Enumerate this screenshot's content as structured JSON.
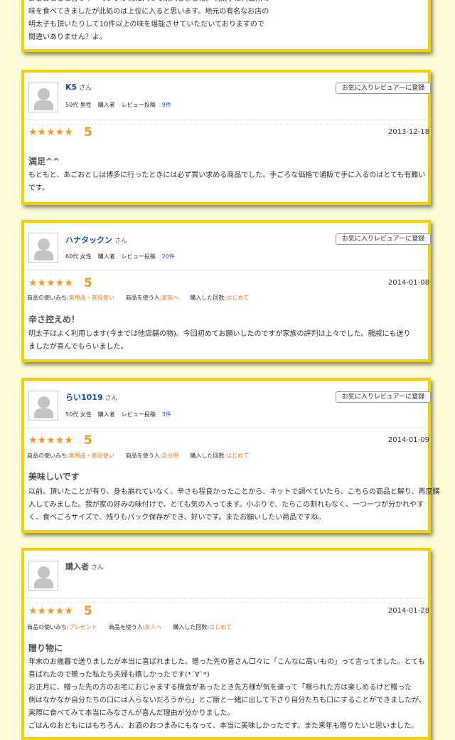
{
  "top_review": {
    "lines": [
      "あごおとしと言うネーミングが気に入って購入しました。明太子は何面所の",
      "味を食べてきましたが此処のは上位に入ると思います。地元の有名なお店の",
      "明太子も頂いたりして10件以上の味を堪能させていただいておりますので",
      "間違いありません？よ。"
    ]
  },
  "labels": {
    "san": "さん",
    "fav_button": "お気に入りレビュアーに登録",
    "buyer": "購入者",
    "review_posts": "レビュー投稿",
    "usage": "商品の使いみち:",
    "user": "商品を使う人:",
    "times": "購入した回数:"
  },
  "reviews": [
    {
      "name": "K5",
      "age_gender": "50代 男性",
      "count": "9件",
      "stars": "★★★★★",
      "score": "5",
      "date": "2013-12-18",
      "title": "満足^^",
      "body": [
        "もともと、あごおとしは博多に行ったときには必ず買い求める商品でした。手ごろな価格で通販で手に入るのはとても有難い",
        "です。"
      ]
    },
    {
      "name": "ハナタックン",
      "age_gender": "60代 女性",
      "count": "20件",
      "stars": "★★★★★",
      "score": "5",
      "date": "2014-01-08",
      "usage": "実用品・普段使い",
      "user": "家族へ",
      "times": "はじめて",
      "title": "辛さ控えめ！",
      "body": [
        "明太子はよく利用します(今までは他店舗の物)。今回初めてお願いしたのですが家族の評判は上々でした。親戚にも送り",
        "ましたが喜んでもらいました。"
      ]
    },
    {
      "name": "らい1019",
      "age_gender": "50代 女性",
      "count": "3件",
      "stars": "★★★★★",
      "score": "5",
      "date": "2014-01-09",
      "usage": "実用品・普段使い",
      "user": "自分用",
      "times": "はじめて",
      "title": "美味しいです",
      "body": [
        "以前、頂いたことが有り、身も崩れていなく、辛さも程良かったことから、ネットで調べていたら、こちらの商品と解り、再度購",
        "入してみました。我が家の好みの味付けで、とても気の入ってます。小ぶりで、たらこの割れもなく、一つ一つが分かれやす",
        "く、食べごろサイズで、残りもパック保存ができ、好いです。またお願いしたい商品ですね。"
      ]
    },
    {
      "name": "購入者",
      "stars": "★★★★★",
      "score": "5",
      "date": "2014-01-28",
      "usage": "プレゼント",
      "user": "友人へ",
      "times": "はじめて",
      "title": "贈り物に",
      "body": [
        "年末のお歳暮で送りましたが本当に喜ばれました。贈った先の皆さん口々に「こんなに高いもの」って言ってました。とても",
        "喜ばれたので贈った私たち夫婦も嬉しかったです(*´∀`*)",
        "お正月に、贈った先の方のお宅におじゃまする機会があったとき先方様が気を遣って「贈られた方は楽しめるけど贈った",
        "側はなかなか自分たちの口には入らないだろうから」とご飯と一緒に出して下さり自分たちも口にすることができましたが、",
        "実際に食べてみて本当にみなさんが喜んだ理由が分かりました。",
        "ごはんのおともにはもちろん、お酒のおつまみにもなって、本当に美味しかったです。また来年も贈りたいと思いました。"
      ]
    }
  ]
}
